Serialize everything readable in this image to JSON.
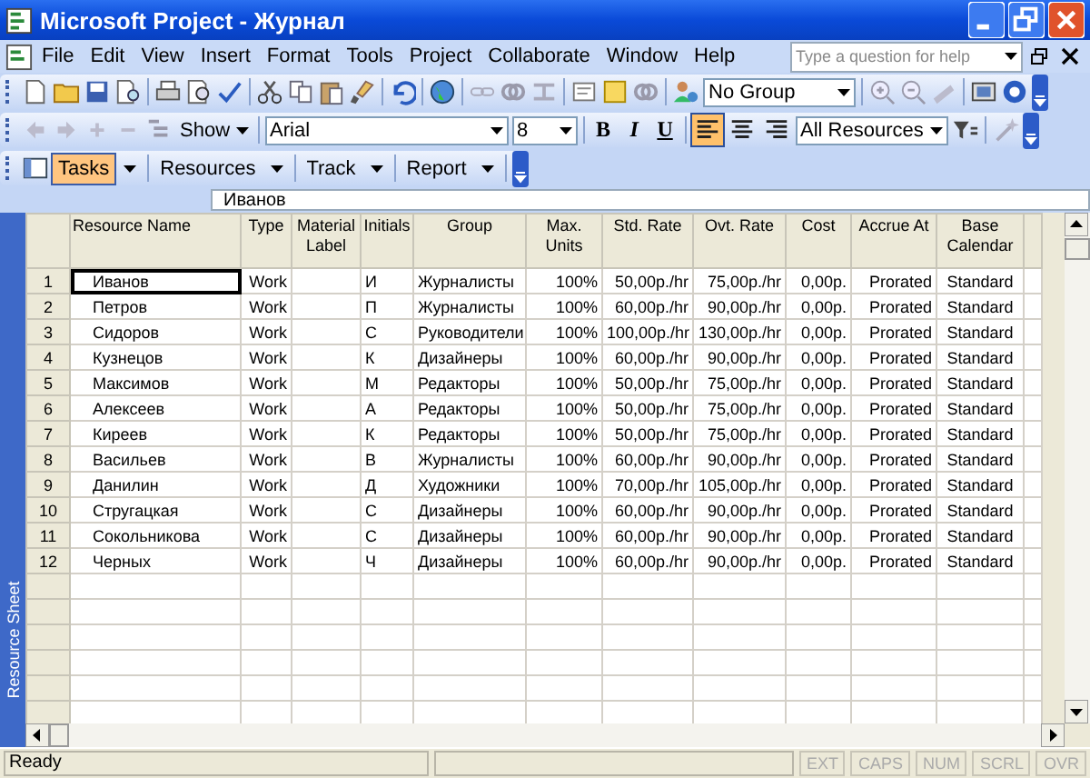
{
  "window": {
    "title": "Microsoft Project - Журнал"
  },
  "menu": [
    "File",
    "Edit",
    "View",
    "Insert",
    "Format",
    "Tools",
    "Project",
    "Collaborate",
    "Window",
    "Help"
  ],
  "help_search": {
    "placeholder": "Type a question for help"
  },
  "standard_toolbar": {
    "group_dropdown": "No Group"
  },
  "formatting_toolbar": {
    "show_button": "Show",
    "font": "Arial",
    "font_size": "8",
    "styles": [
      {
        "label": "B",
        "kind": "bold"
      },
      {
        "label": "I",
        "kind": "italic"
      },
      {
        "label": "U",
        "kind": "underline"
      }
    ],
    "alignment": [
      {
        "kind": "left",
        "selected": true
      },
      {
        "kind": "center",
        "selected": false
      },
      {
        "kind": "right",
        "selected": false
      }
    ],
    "filter": "All Resources"
  },
  "views_toolbar": [
    {
      "label": "Tasks",
      "selected": true
    },
    {
      "label": "Resources",
      "selected": false
    },
    {
      "label": "Track",
      "selected": false
    },
    {
      "label": "Report",
      "selected": false
    }
  ],
  "entry_bar": {
    "value": "Иванов"
  },
  "view_bar": {
    "label": "Resource Sheet"
  },
  "table": {
    "columns": [
      "Resource Name",
      "Type",
      "Material Label",
      "Initials",
      "Group",
      "Max. Units",
      "Std. Rate",
      "Ovt. Rate",
      "Cost",
      "Accrue At",
      "Base Calendar"
    ],
    "rows": [
      {
        "id": "1",
        "selected": true,
        "cells": [
          "Иванов",
          "Work",
          "",
          "И",
          "Журналисты",
          "100%",
          "50,00р./hr",
          "75,00р./hr",
          "0,00р.",
          "Prorated",
          "Standard"
        ]
      },
      {
        "id": "2",
        "selected": false,
        "cells": [
          "Петров",
          "Work",
          "",
          "П",
          "Журналисты",
          "100%",
          "60,00р./hr",
          "90,00р./hr",
          "0,00р.",
          "Prorated",
          "Standard"
        ]
      },
      {
        "id": "3",
        "selected": false,
        "cells": [
          "Сидоров",
          "Work",
          "",
          "С",
          "Руководители",
          "100%",
          "100,00р./hr",
          "130,00р./hr",
          "0,00р.",
          "Prorated",
          "Standard"
        ]
      },
      {
        "id": "4",
        "selected": false,
        "cells": [
          "Кузнецов",
          "Work",
          "",
          "К",
          "Дизайнеры",
          "100%",
          "60,00р./hr",
          "90,00р./hr",
          "0,00р.",
          "Prorated",
          "Standard"
        ]
      },
      {
        "id": "5",
        "selected": false,
        "cells": [
          "Максимов",
          "Work",
          "",
          "М",
          "Редакторы",
          "100%",
          "50,00р./hr",
          "75,00р./hr",
          "0,00р.",
          "Prorated",
          "Standard"
        ]
      },
      {
        "id": "6",
        "selected": false,
        "cells": [
          "Алексеев",
          "Work",
          "",
          "А",
          "Редакторы",
          "100%",
          "50,00р./hr",
          "75,00р./hr",
          "0,00р.",
          "Prorated",
          "Standard"
        ]
      },
      {
        "id": "7",
        "selected": false,
        "cells": [
          "Киреев",
          "Work",
          "",
          "К",
          "Редакторы",
          "100%",
          "50,00р./hr",
          "75,00р./hr",
          "0,00р.",
          "Prorated",
          "Standard"
        ]
      },
      {
        "id": "8",
        "selected": false,
        "cells": [
          "Васильев",
          "Work",
          "",
          "В",
          "Журналисты",
          "100%",
          "60,00р./hr",
          "90,00р./hr",
          "0,00р.",
          "Prorated",
          "Standard"
        ]
      },
      {
        "id": "9",
        "selected": false,
        "cells": [
          "Данилин",
          "Work",
          "",
          "Д",
          "Художники",
          "100%",
          "70,00р./hr",
          "105,00р./hr",
          "0,00р.",
          "Prorated",
          "Standard"
        ]
      },
      {
        "id": "10",
        "selected": false,
        "cells": [
          "Стругацкая",
          "Work",
          "",
          "С",
          "Дизайнеры",
          "100%",
          "60,00р./hr",
          "90,00р./hr",
          "0,00р.",
          "Prorated",
          "Standard"
        ]
      },
      {
        "id": "11",
        "selected": false,
        "cells": [
          "Сокольникова",
          "Work",
          "",
          "С",
          "Дизайнеры",
          "100%",
          "60,00р./hr",
          "90,00р./hr",
          "0,00р.",
          "Prorated",
          "Standard"
        ]
      },
      {
        "id": "12",
        "selected": false,
        "cells": [
          "Черных",
          "Work",
          "",
          "Ч",
          "Дизайнеры",
          "100%",
          "60,00р./hr",
          "90,00р./hr",
          "0,00р.",
          "Prorated",
          "Standard"
        ]
      }
    ]
  },
  "status_bar": {
    "text": "Ready",
    "indicators": [
      {
        "label": "EXT",
        "on": false
      },
      {
        "label": "CAPS",
        "on": false
      },
      {
        "label": "NUM",
        "on": false
      },
      {
        "label": "SCRL",
        "on": false
      },
      {
        "label": "OVR",
        "on": false
      }
    ]
  }
}
